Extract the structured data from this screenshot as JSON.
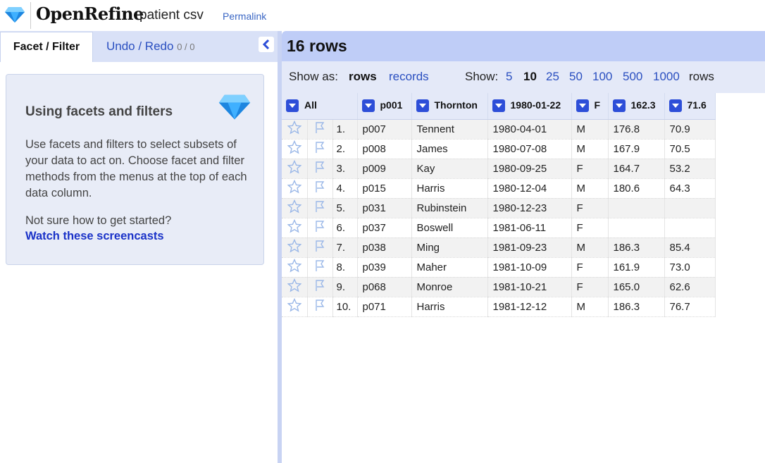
{
  "header": {
    "brand": "OpenRefine",
    "project_name": "patient csv",
    "permalink": "Permalink"
  },
  "left_panel": {
    "tab_facet": "Facet / Filter",
    "tab_undo": "Undo / Redo",
    "undo_count": "0 / 0",
    "help": {
      "title": "Using facets and filters",
      "body": "Use facets and filters to select subsets of your data to act on. Choose facet and filter methods from the menus at the top of each data column.",
      "not_sure": "Not sure how to get started?",
      "link": "Watch these screencasts"
    }
  },
  "right_panel": {
    "row_count": "16 rows",
    "show_as_label": "Show as:",
    "show_as_rows": "rows",
    "show_as_records": "records",
    "show_label": "Show:",
    "page_sizes": [
      "5",
      "10",
      "25",
      "50",
      "100",
      "500",
      "1000"
    ],
    "current_page_size": "10",
    "show_suffix": "rows"
  },
  "table": {
    "columns": [
      "All",
      "p001",
      "Thornton",
      "1980-01-22",
      "F",
      "162.3",
      "71.6"
    ],
    "rows": [
      {
        "idx": "1.",
        "cells": [
          "p007",
          "Tennent",
          "1980-04-01",
          "M",
          "176.8",
          "70.9"
        ]
      },
      {
        "idx": "2.",
        "cells": [
          "p008",
          "James",
          "1980-07-08",
          "M",
          "167.9",
          "70.5"
        ]
      },
      {
        "idx": "3.",
        "cells": [
          "p009",
          "Kay",
          "1980-09-25",
          "F",
          "164.7",
          "53.2"
        ]
      },
      {
        "idx": "4.",
        "cells": [
          "p015",
          "Harris",
          "1980-12-04",
          "M",
          "180.6",
          "64.3"
        ]
      },
      {
        "idx": "5.",
        "cells": [
          "p031",
          "Rubinstein",
          "1980-12-23",
          "F",
          "",
          ""
        ]
      },
      {
        "idx": "6.",
        "cells": [
          "p037",
          "Boswell",
          "1981-06-11",
          "F",
          "",
          ""
        ]
      },
      {
        "idx": "7.",
        "cells": [
          "p038",
          "Ming",
          "1981-09-23",
          "M",
          "186.3",
          "85.4"
        ]
      },
      {
        "idx": "8.",
        "cells": [
          "p039",
          "Maher",
          "1981-10-09",
          "F",
          "161.9",
          "73.0"
        ]
      },
      {
        "idx": "9.",
        "cells": [
          "p068",
          "Monroe",
          "1981-10-21",
          "F",
          "165.0",
          "62.6"
        ]
      },
      {
        "idx": "10.",
        "cells": [
          "p071",
          "Harris",
          "1981-12-12",
          "M",
          "186.3",
          "76.7"
        ]
      }
    ]
  },
  "icons": {
    "logo": "diamond-icon",
    "collapse": "chevron-left-icon",
    "star": "star-icon",
    "flag": "flag-icon",
    "dropdown": "dropdown-arrow-icon"
  },
  "colors": {
    "accent_blue": "#2d4ed8",
    "link_blue": "#2a4fc0",
    "header_bar": "#bfcdf7",
    "view_bar": "#e4e9f8"
  }
}
